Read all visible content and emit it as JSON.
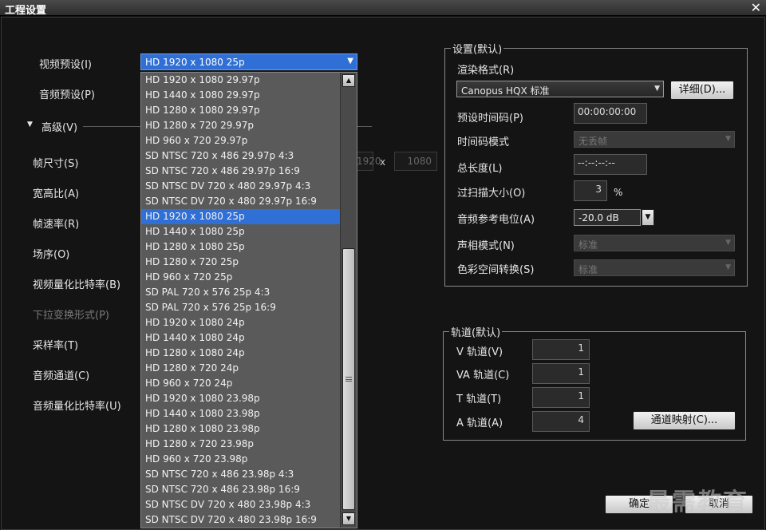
{
  "window": {
    "title": "工程设置",
    "close": "✕"
  },
  "left": {
    "video_preset_label": "视频预设(I)",
    "audio_preset_label": "音频预设(P)",
    "advanced_label": "高级(V)",
    "frame_size_label": "帧尺寸(S)",
    "aspect_label": "宽高比(A)",
    "frame_rate_label": "帧速率(R)",
    "field_order_label": "场序(O)",
    "video_bit_depth_label": "视频量化比特率(B)",
    "pulldown_label": "下拉变换形式(P)",
    "sample_rate_label": "采样率(T)",
    "audio_channels_label": "音频通道(C)",
    "audio_bit_depth_label": "音频量化比特率(U)",
    "width_value": "1920",
    "height_value": "1080",
    "x_sep": "x"
  },
  "preset": {
    "selected": "HD 1920 x 1080 25p",
    "options": [
      "HD 1920 x 1080 29.97p",
      "HD 1440 x 1080 29.97p",
      "HD 1280 x 1080 29.97p",
      "HD 1280 x 720 29.97p",
      "HD 960 x 720 29.97p",
      "SD NTSC 720 x 486 29.97p 4:3",
      "SD NTSC 720 x 486 29.97p 16:9",
      "SD NTSC DV 720 x 480 29.97p 4:3",
      "SD NTSC DV 720 x 480 29.97p 16:9",
      "HD 1920 x 1080 25p",
      "HD 1440 x 1080 25p",
      "HD 1280 x 1080 25p",
      "HD 1280 x 720 25p",
      "HD 960 x 720 25p",
      "SD PAL 720 x 576 25p 4:3",
      "SD PAL 720 x 576 25p 16:9",
      "HD 1920 x 1080 24p",
      "HD 1440 x 1080 24p",
      "HD 1280 x 1080 24p",
      "HD 1280 x 720 24p",
      "HD 960 x 720 24p",
      "HD 1920 x 1080 23.98p",
      "HD 1440 x 1080 23.98p",
      "HD 1280 x 1080 23.98p",
      "HD 1280 x 720 23.98p",
      "HD 960 x 720 23.98p",
      "SD NTSC 720 x 486 23.98p 4:3",
      "SD NTSC 720 x 486 23.98p 16:9",
      "SD NTSC DV 720 x 480 23.98p 4:3",
      "SD NTSC DV 720 x 480 23.98p 16:9"
    ]
  },
  "settings": {
    "group_title": "设置(默认)",
    "render_format_label": "渲染格式(R)",
    "render_format_value": "Canopus HQX 标准",
    "detail_button": "详细(D)...",
    "preset_timecode_label": "预设时间码(P)",
    "preset_timecode_value": "00:00:00:00",
    "timecode_mode_label": "时间码模式",
    "timecode_mode_value": "无丢帧",
    "total_length_label": "总长度(L)",
    "total_length_value": "--:--:--:--",
    "overscan_label": "过扫描大小(O)",
    "overscan_value": "3",
    "overscan_unit": "%",
    "audio_ref_label": "音频参考电位(A)",
    "audio_ref_value": "-20.0 dB",
    "pan_mode_label": "声相模式(N)",
    "pan_mode_value": "标准",
    "color_space_label": "色彩空间转换(S)",
    "color_space_value": "标准"
  },
  "tracks": {
    "group_title": "轨道(默认)",
    "v_label": "V 轨道(V)",
    "v_value": "1",
    "va_label": "VA 轨道(C)",
    "va_value": "1",
    "t_label": "T 轨道(T)",
    "t_value": "1",
    "a_label": "A 轨道(A)",
    "a_value": "4",
    "mapping_button": "通道映射(C)..."
  },
  "footer": {
    "ok_button": "确定",
    "cancel_button": "取消"
  },
  "watermark": "最需教育",
  "icons": {
    "close": "close-icon",
    "dropdown": "chevron-down-icon",
    "up": "scroll-up-icon",
    "down": "scroll-down-icon"
  }
}
